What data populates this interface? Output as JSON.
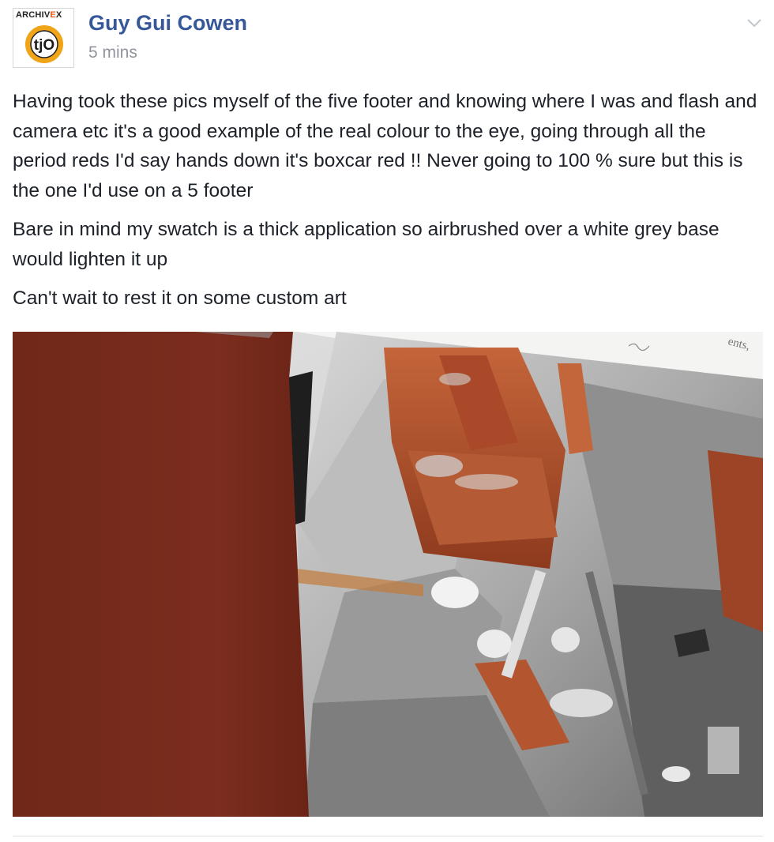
{
  "post": {
    "avatar": {
      "brand_prefix": "ARCHIV",
      "brand_accent": "E",
      "brand_suffix": "X",
      "monogram": "tjO",
      "ring_color": "#f0a417"
    },
    "author": "Guy Gui Cowen",
    "timestamp": "5 mins",
    "menu_icon": "chevron-down-icon",
    "paragraphs": [
      "Having took these pics myself of the five footer and knowing where I was and flash and camera etc it's a good example of the real colour to the eye, going through all the period reds I'd say hands down it's boxcar red !! Never going to 100 % sure but this is the one I'd use on a 5 footer",
      "Bare in mind my swatch is a thick application so airbrushed over a white grey base would lighten it up",
      "Can't wait to rest it on some custom art"
    ],
    "photo": {
      "swatch_color": "#7a2c1f",
      "model_rust_color": "#b8572e",
      "paper_text": "ents,"
    }
  }
}
